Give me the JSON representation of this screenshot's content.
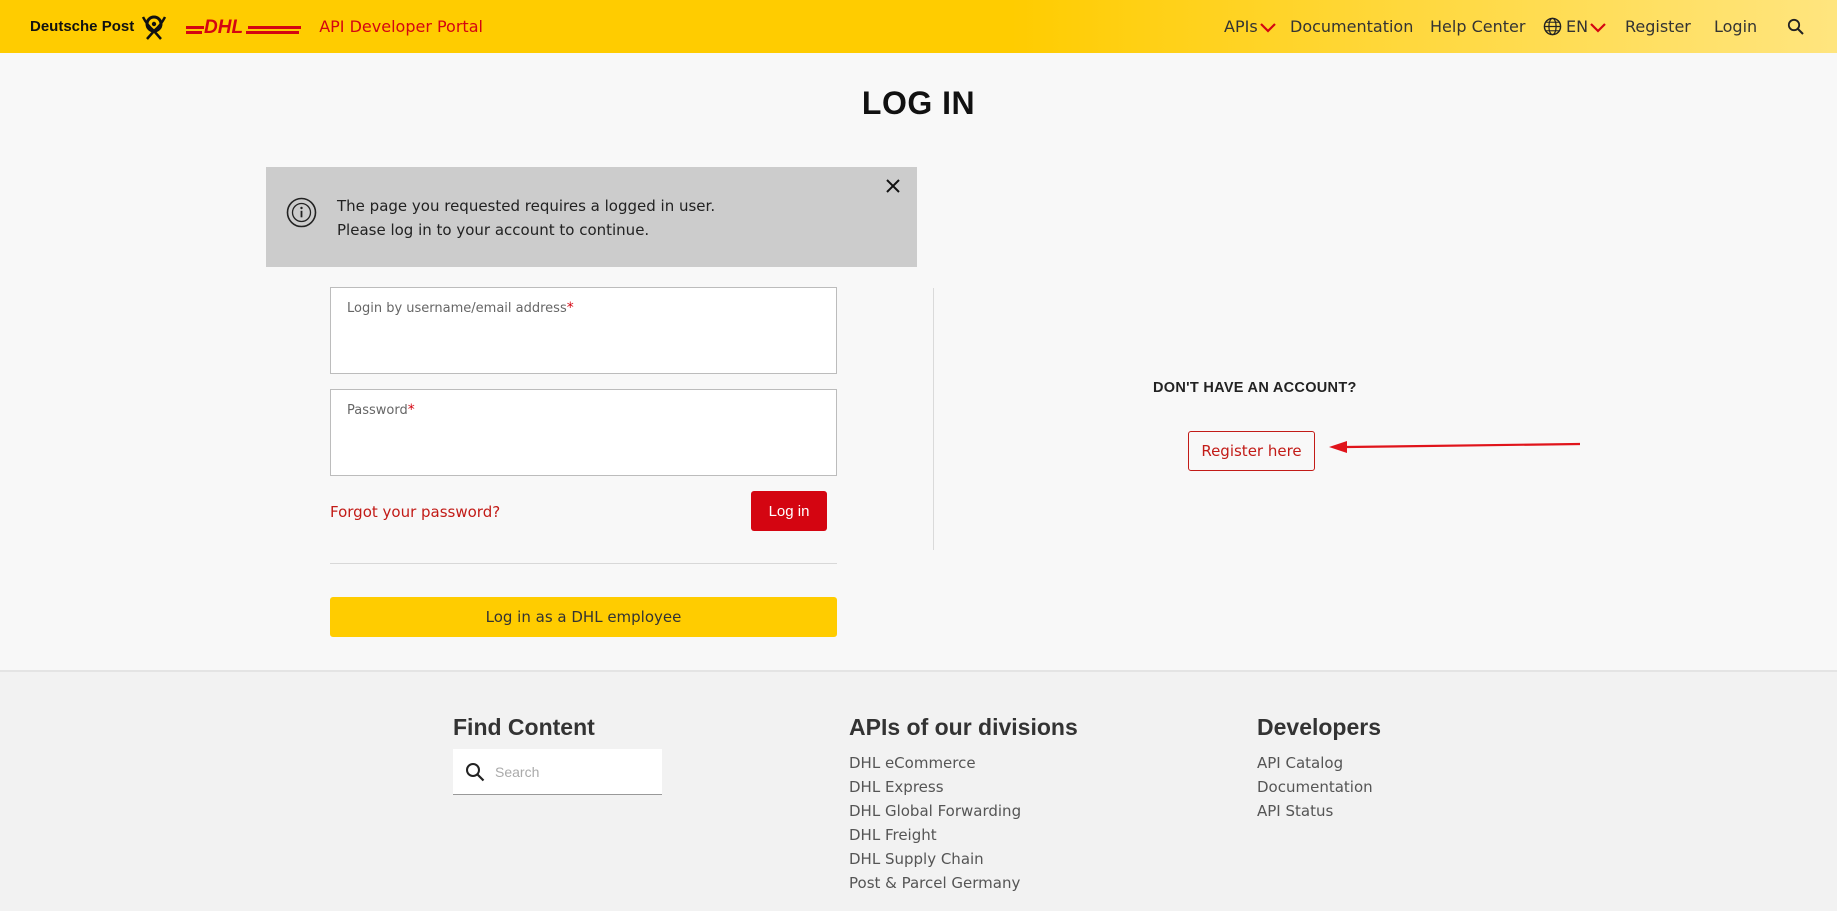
{
  "header": {
    "deutsche_post_label": "Deutsche Post",
    "portal_title": "API Developer Portal",
    "nav": {
      "apis": "APIs",
      "documentation": "Documentation",
      "help_center": "Help Center",
      "language": "EN",
      "register": "Register",
      "login": "Login"
    },
    "icons": [
      "post-horn-icon",
      "dhl-logo",
      "chevron-down-icon",
      "globe-icon",
      "search-icon"
    ],
    "colors": {
      "brand_yellow": "#ffcc00",
      "brand_red": "#d40511"
    }
  },
  "main": {
    "title": "LOG IN",
    "alert": {
      "line1": "The page you requested requires a logged in user.",
      "line2": "Please log in to your account to continue.",
      "icons": [
        "info-icon",
        "close-icon"
      ]
    },
    "form": {
      "username_label": "Login by username/email address",
      "username_value": "",
      "password_label": "Password",
      "password_value": "",
      "required_mark": "*",
      "forgot_password": "Forgot your password?",
      "login_button": "Log in",
      "employee_button": "Log in as a DHL employee"
    },
    "register_panel": {
      "heading": "DON'T HAVE AN ACCOUNT?",
      "button": "Register here"
    }
  },
  "footer": {
    "find_content": {
      "title": "Find Content",
      "search_placeholder": "Search"
    },
    "divisions": {
      "title": "APIs of our divisions",
      "links": [
        "DHL eCommerce",
        "DHL Express",
        "DHL Global Forwarding",
        "DHL Freight",
        "DHL Supply Chain",
        "Post & Parcel Germany"
      ]
    },
    "developers": {
      "title": "Developers",
      "links": [
        "API Catalog",
        "Documentation",
        "API Status"
      ]
    }
  }
}
